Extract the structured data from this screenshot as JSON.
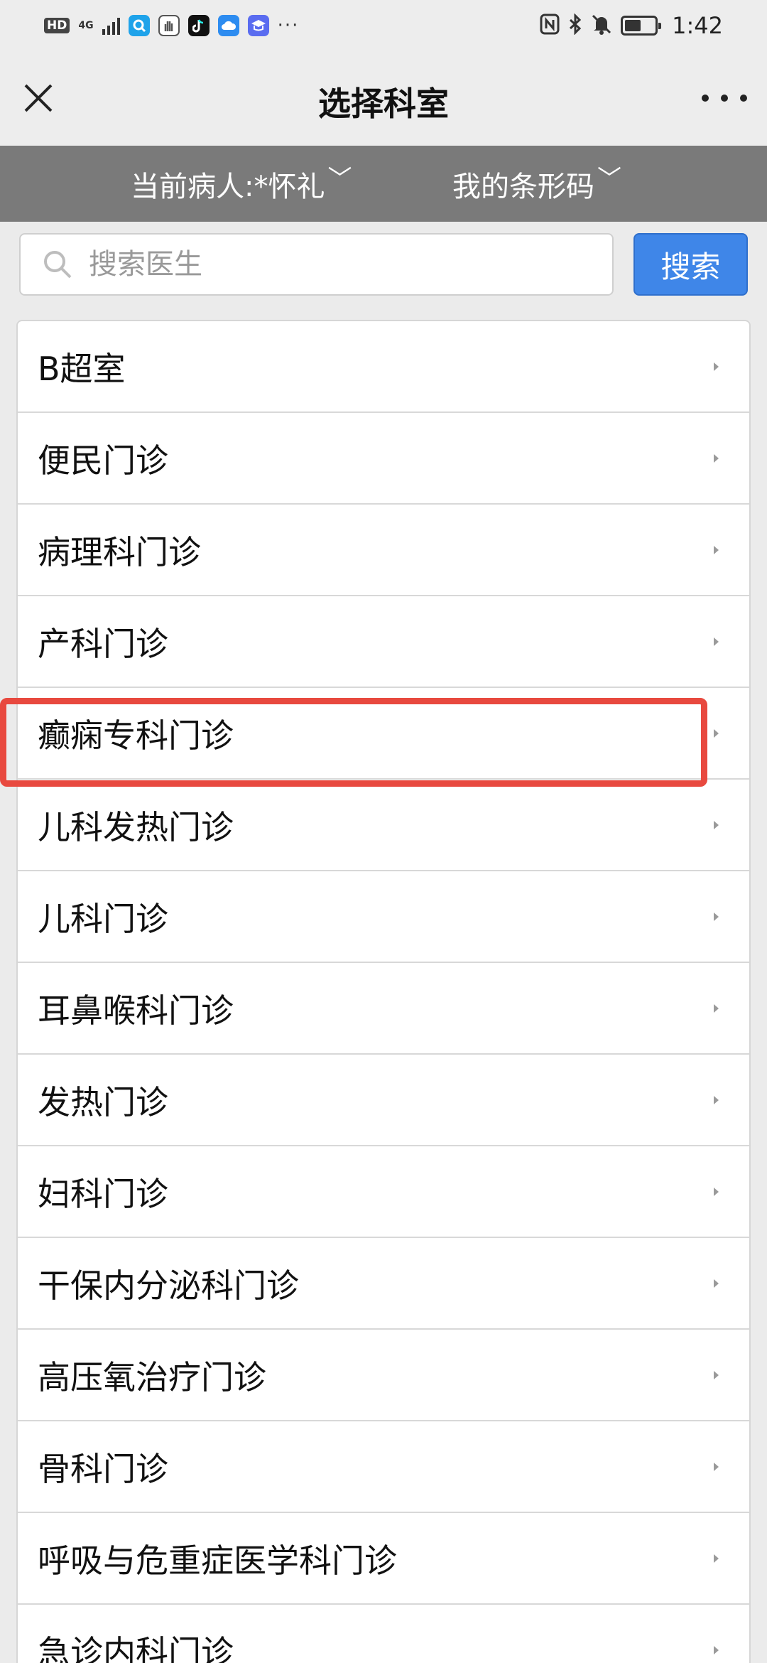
{
  "status_bar": {
    "hd_badge": "HD",
    "network": "4G",
    "time": "1:42",
    "more_dots": "···",
    "battery_level": 0.55,
    "left_icons": [
      "hd-icon",
      "signal-icon",
      "search-app-icon",
      "hand-app-icon",
      "tiktok-icon",
      "cloud-icon",
      "school-icon"
    ],
    "right_icons": [
      "nfc-icon",
      "bluetooth-icon",
      "mute-icon",
      "battery-icon"
    ]
  },
  "header": {
    "title": "选择科室",
    "close_icon": "close-icon",
    "more_icon": "more-icon"
  },
  "patient_bar": {
    "patient_label": "当前病人:*怀礼",
    "barcode_label": "我的条形码",
    "caret": "﹀"
  },
  "search": {
    "placeholder": "搜索医生",
    "value": "",
    "button_label": "搜索"
  },
  "departments": [
    "B超室",
    "便民门诊",
    "病理科门诊",
    "产科门诊",
    "癫痫专科门诊",
    "儿科发热门诊",
    "儿科门诊",
    "耳鼻喉科门诊",
    "发热门诊",
    "妇科门诊",
    "干保内分泌科门诊",
    "高压氧治疗门诊",
    "骨科门诊",
    "呼吸与危重症医学科门诊",
    "急诊内科门诊"
  ],
  "highlighted_department": "癫痫专科门诊",
  "colors": {
    "patient_bar_bg": "#7a7a7a",
    "search_button": "#3f86e8",
    "highlight": "#e8493f"
  }
}
